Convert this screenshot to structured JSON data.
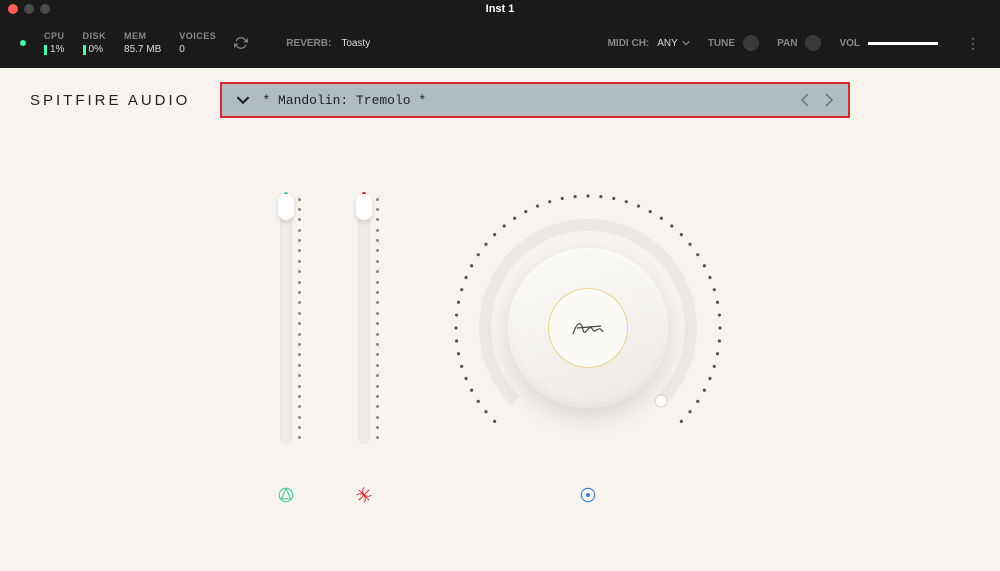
{
  "window": {
    "title": "Inst 1"
  },
  "toolbar": {
    "cpu": {
      "label": "CPU",
      "value": "1%"
    },
    "disk": {
      "label": "DISK",
      "value": "0%"
    },
    "mem": {
      "label": "MEM",
      "value": "85.7 MB"
    },
    "voices": {
      "label": "VOICES",
      "value": "0"
    },
    "reverb": {
      "label": "REVERB:",
      "value": "Toasty"
    },
    "midi": {
      "label": "MIDI CH:",
      "value": "ANY"
    },
    "tune": {
      "label": "TUNE"
    },
    "pan": {
      "label": "PAN"
    },
    "vol": {
      "label": "VOL"
    }
  },
  "brand": "SPITFIRE AUDIO",
  "preset": {
    "name": "* Mandolin: Tremolo *"
  },
  "colors": {
    "highlight_border": "#d4272e",
    "slider1_led": "#4fc89a",
    "slider2_led": "#d4272e",
    "knob_icon": "#3a7fd4"
  }
}
